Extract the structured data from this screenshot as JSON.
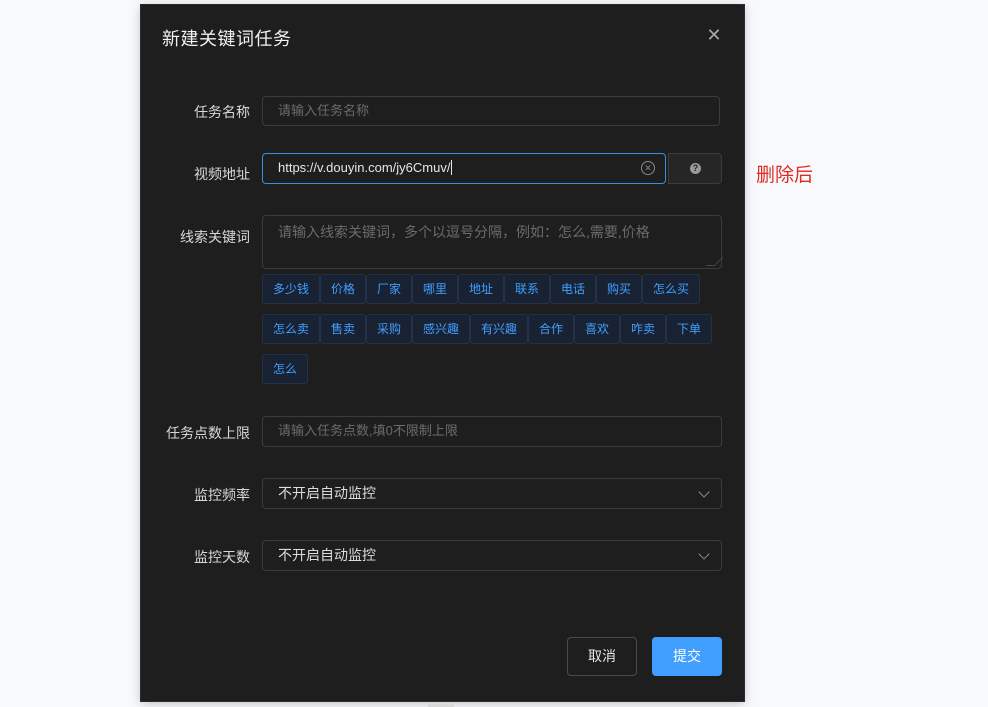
{
  "modal": {
    "title": "新建关键词任务",
    "close_icon": "close-icon",
    "task_name": {
      "label": "任务名称",
      "placeholder": "请输入任务名称"
    },
    "video_url": {
      "label": "视频地址",
      "value": "https://v.douyin.com/jy6Cmuv/"
    },
    "keywords": {
      "label": "线索关键词",
      "placeholder": "请输入线索关键词，多个以逗号分隔，例如：怎么,需要,价格",
      "tags": [
        "多少钱",
        "价格",
        "厂家",
        "哪里",
        "地址",
        "联系",
        "电话",
        "购买",
        "怎么买",
        "怎么卖",
        "售卖",
        "采购",
        "感兴趣",
        "有兴趣",
        "合作",
        "喜欢",
        "咋卖",
        "下单",
        "怎么"
      ]
    },
    "points_limit": {
      "label": "任务点数上限",
      "placeholder": "请输入任务点数,填0不限制上限"
    },
    "monitor_frequency": {
      "label": "监控频率",
      "value": "不开启自动监控"
    },
    "monitor_days": {
      "label": "监控天数",
      "value": "不开启自动监控"
    },
    "buttons": {
      "cancel": "取消",
      "submit": "提交"
    }
  },
  "annotation": "删除后",
  "colors": {
    "accent": "#409eff",
    "annotation": "#e02a23",
    "modal_bg": "#1e1e1e"
  }
}
